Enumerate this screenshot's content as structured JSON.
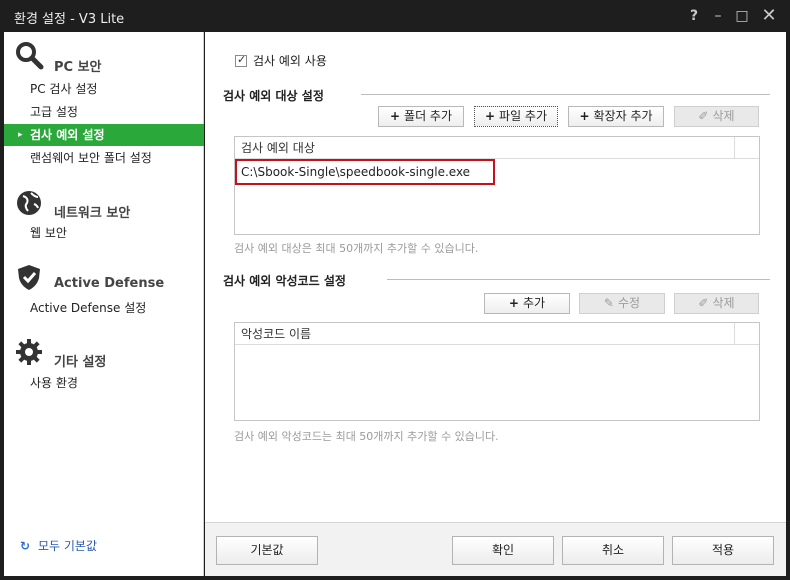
{
  "window": {
    "title": "환경 설정 - V3 Lite",
    "help": "?",
    "minimize": "–",
    "maximize": "□",
    "close": "✕"
  },
  "sidebar": {
    "sections": [
      {
        "title": "PC 보안",
        "icon": "magnifier-icon",
        "items": [
          "PC 검사 설정",
          "고급 설정",
          "검사 예외 설정",
          "랜섬웨어 보안 폴더 설정"
        ]
      },
      {
        "title": "네트워크 보안",
        "icon": "globe-icon",
        "items": [
          "웹 보안"
        ]
      },
      {
        "title": "Active Defense",
        "icon": "shield-check-icon",
        "items": [
          "Active Defense 설정"
        ]
      },
      {
        "title": "기타 설정",
        "icon": "gear-icon",
        "items": [
          "사용 환경"
        ]
      }
    ],
    "active_item": "검사 예외 설정",
    "reset_all": "모두 기본값"
  },
  "main": {
    "enable_exclusion": {
      "label": "검사 예외 사용",
      "checked": true
    },
    "target_group": {
      "title": "검사 예외 대상 설정",
      "buttons": {
        "add_folder": "폴더 추가",
        "add_file": "파일 추가",
        "add_ext": "확장자 추가",
        "delete": "삭제"
      },
      "column": "검사 예외 대상",
      "rows": [
        "C:\\Sbook-Single\\speedbook-single.exe"
      ],
      "hint": "검사 예외 대상은 최대 50개까지 추가할 수 있습니다."
    },
    "malware_group": {
      "title": "검사 예외 악성코드 설정",
      "buttons": {
        "add": "추가",
        "edit": "수정",
        "delete": "삭제"
      },
      "column": "악성코드 이름",
      "hint": "검사 예외 악성코드는 최대 50개까지 추가할 수 있습니다."
    }
  },
  "footer": {
    "default": "기본값",
    "ok": "확인",
    "cancel": "취소",
    "apply": "적용"
  },
  "colors": {
    "accent_green": "#2aa83a",
    "highlight_red": "#c8101a",
    "link_blue": "#2a5db0"
  }
}
